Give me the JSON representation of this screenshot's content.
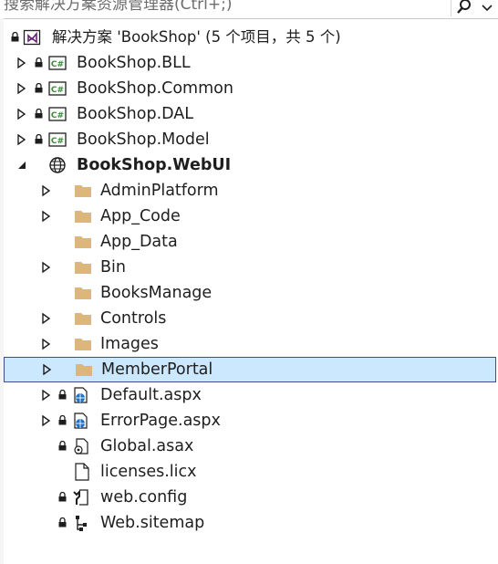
{
  "search": {
    "placeholder": "搜索解决方案资源管理器(Ctrl+;)",
    "value": ""
  },
  "solution": {
    "label": "解决方案 'BookShop' (5 个项目，共 5 个)"
  },
  "projects": [
    {
      "label": "BookShop.BLL"
    },
    {
      "label": "BookShop.Common"
    },
    {
      "label": "BookShop.DAL"
    },
    {
      "label": "BookShop.Model"
    }
  ],
  "web_project": {
    "label": "BookShop.WebUI"
  },
  "folders": [
    {
      "label": "AdminPlatform",
      "expandable": true
    },
    {
      "label": "App_Code",
      "expandable": true
    },
    {
      "label": "App_Data",
      "expandable": false
    },
    {
      "label": "Bin",
      "expandable": true
    },
    {
      "label": "BooksManage",
      "expandable": false
    },
    {
      "label": "Controls",
      "expandable": true
    },
    {
      "label": "Images",
      "expandable": true
    },
    {
      "label": "MemberPortal",
      "expandable": true,
      "selected": true
    }
  ],
  "files": [
    {
      "label": "Default.aspx",
      "icon": "web-page-icon"
    },
    {
      "label": "ErrorPage.aspx",
      "icon": "web-page-icon"
    },
    {
      "label": "Global.asax",
      "icon": "global-asax-icon"
    },
    {
      "label": "licenses.licx",
      "icon": "file-icon"
    },
    {
      "label": "web.config",
      "icon": "config-icon"
    },
    {
      "label": "Web.sitemap",
      "icon": "sitemap-icon"
    }
  ],
  "colors": {
    "selection": "#cce8ff",
    "selection_border": "#3f4f88",
    "folder": "#dcb67a",
    "csharp": "#388a34",
    "vs_purple": "#68217a"
  }
}
